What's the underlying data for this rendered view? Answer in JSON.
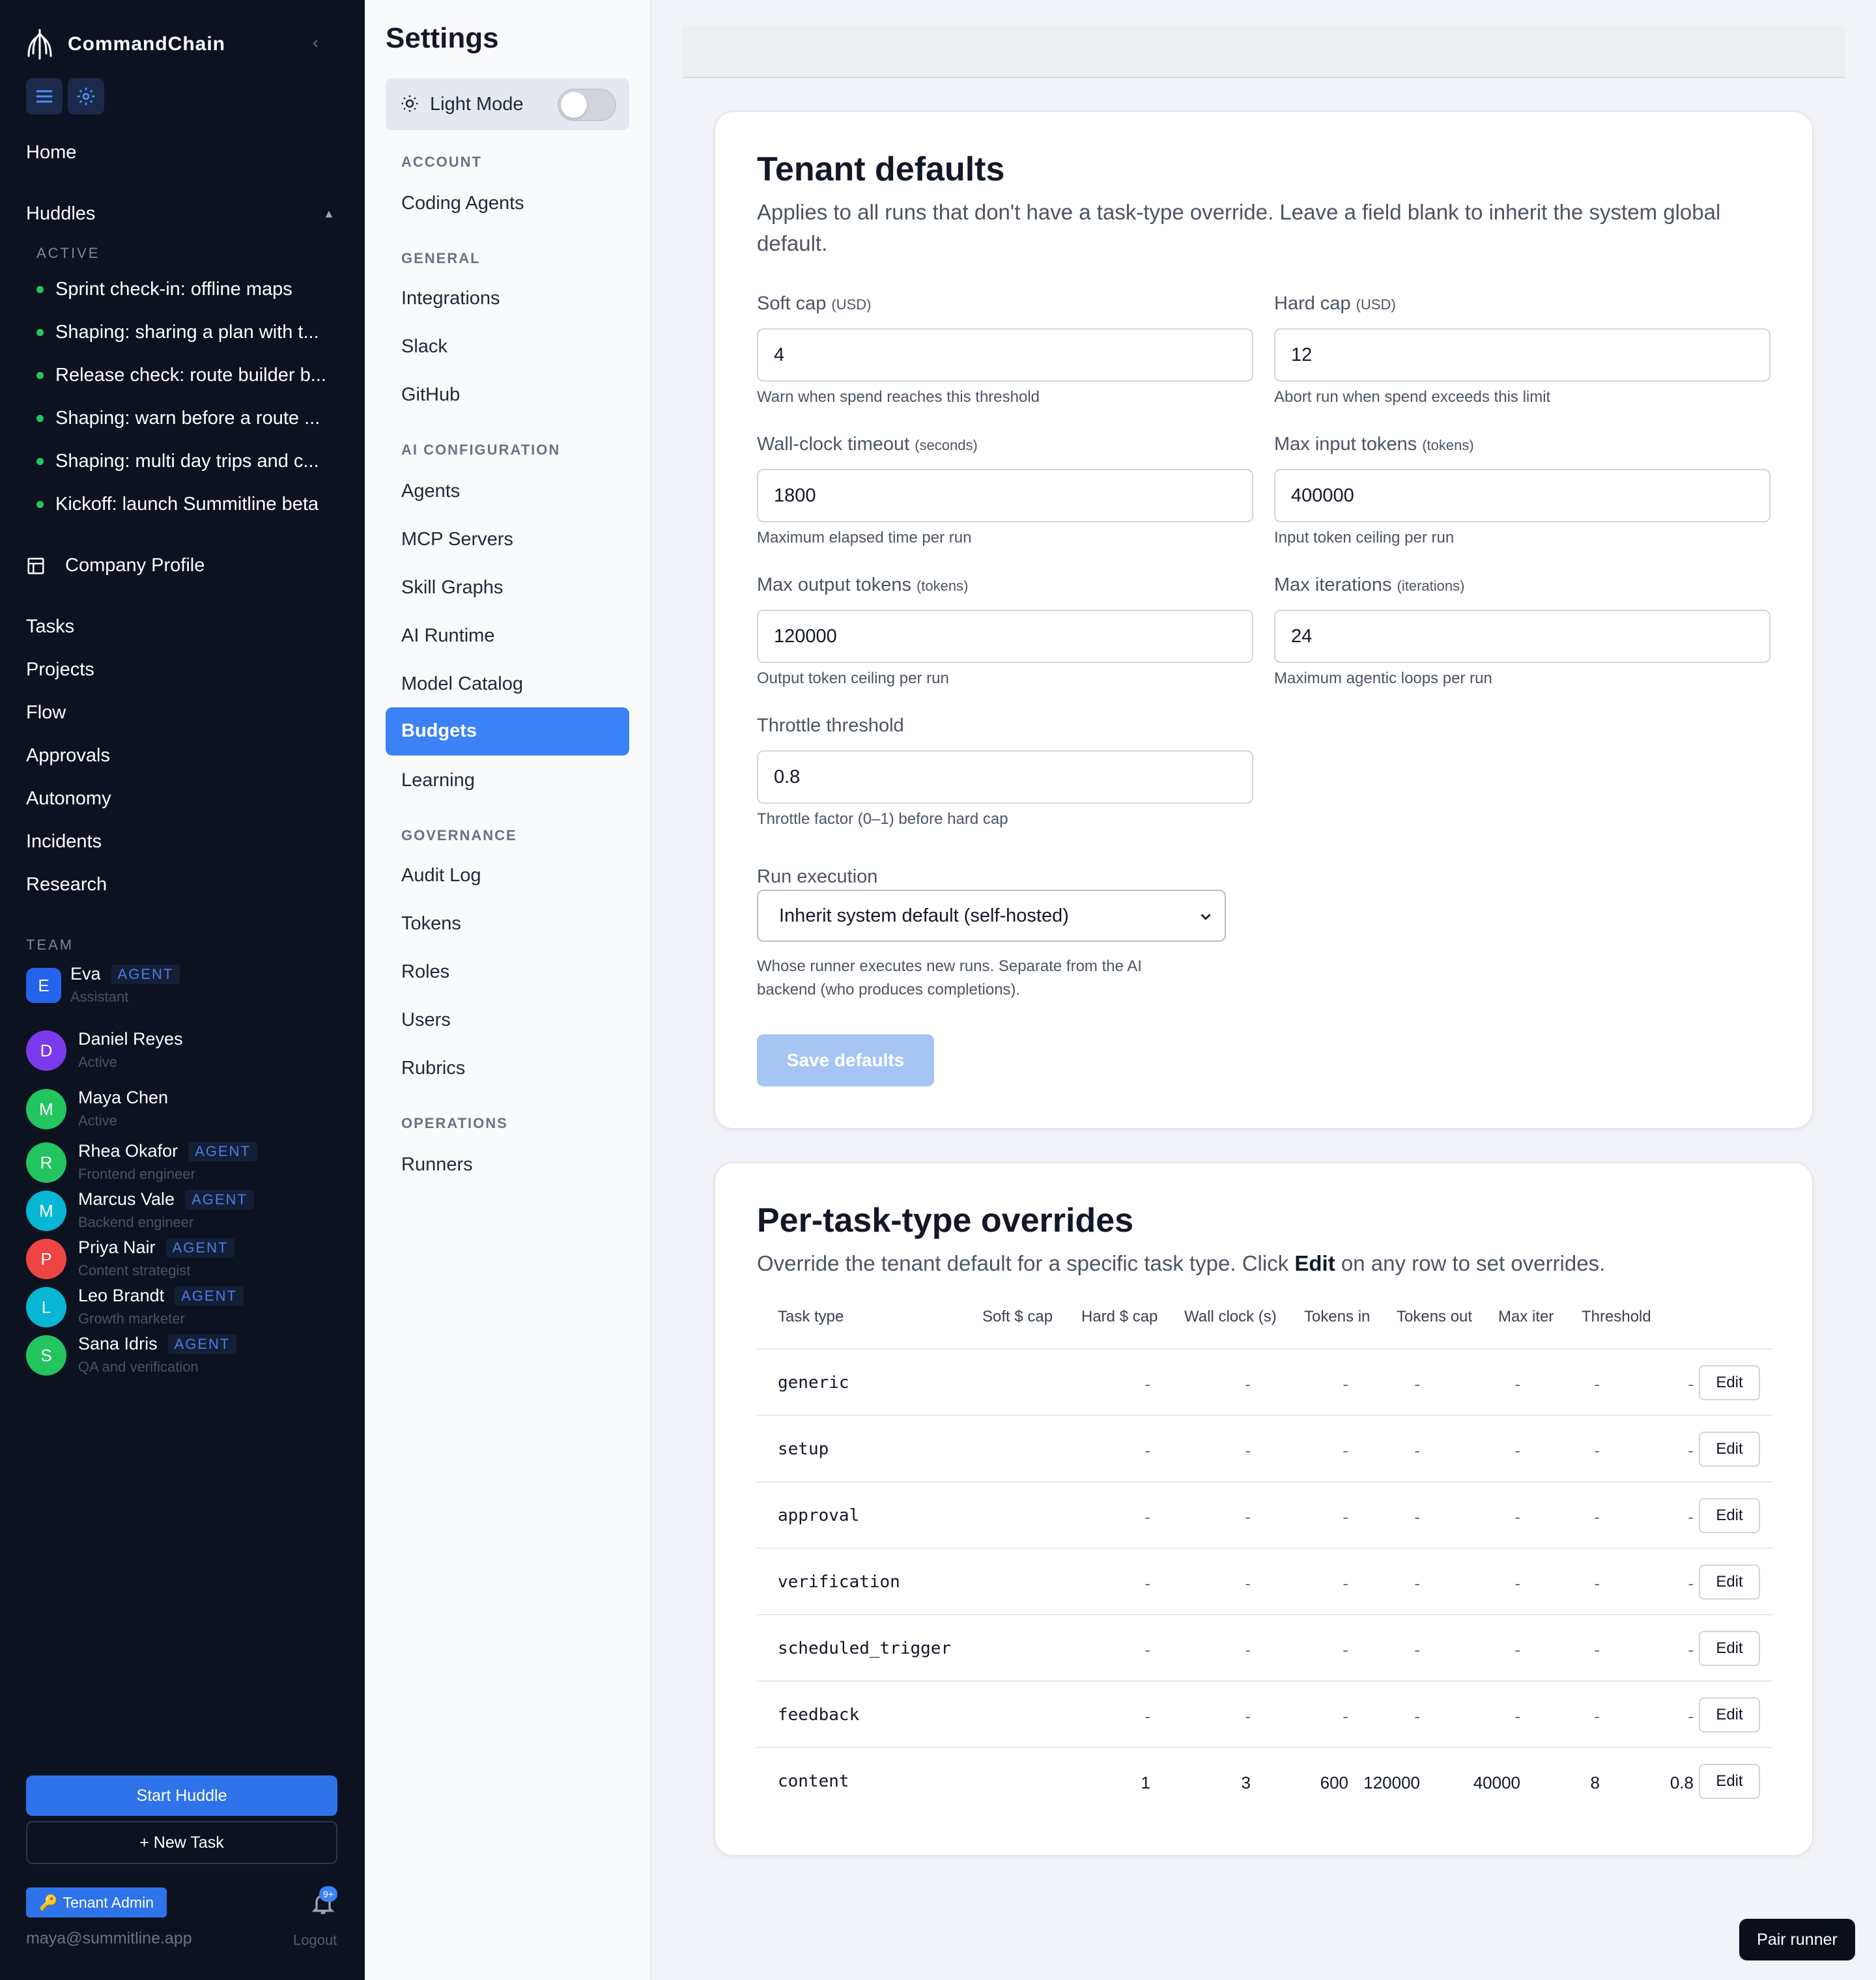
{
  "app": {
    "brand": "CommandChain",
    "collapse": "‹",
    "nav_top": [
      "Home"
    ],
    "huddles_label": "Huddles",
    "active_label": "ACTIVE",
    "huddles": [
      "Sprint check-in: offline maps",
      "Shaping: sharing a plan with t...",
      "Release check: route builder b...",
      "Shaping: warn before a route ...",
      "Shaping: multi day trips and c...",
      "Kickoff: launch Summitline beta"
    ],
    "company_profile": "Company Profile",
    "nav_main": [
      "Tasks",
      "Projects",
      "Flow",
      "Approvals",
      "Autonomy",
      "Incidents",
      "Research"
    ],
    "team_label": "TEAM",
    "agent_tag": "AGENT",
    "team": [
      {
        "initial": "E",
        "name": "Eva",
        "sub": "Assistant",
        "agent": true,
        "color": "#2563eb"
      },
      {
        "initial": "D",
        "name": "Daniel Reyes",
        "sub": "Active",
        "agent": false,
        "color": "#7c3aed"
      },
      {
        "initial": "M",
        "name": "Maya Chen",
        "sub": "Active",
        "agent": false,
        "color": "#22c55e"
      },
      {
        "initial": "R",
        "name": "Rhea Okafor",
        "sub": "Frontend engineer",
        "agent": true,
        "color": "#22c55e"
      },
      {
        "initial": "M",
        "name": "Marcus Vale",
        "sub": "Backend engineer",
        "agent": true,
        "color": "#06b6d4"
      },
      {
        "initial": "P",
        "name": "Priya Nair",
        "sub": "Content strategist",
        "agent": true,
        "color": "#ef4444"
      },
      {
        "initial": "L",
        "name": "Leo Brandt",
        "sub": "Growth marketer",
        "agent": true,
        "color": "#06b6d4"
      },
      {
        "initial": "S",
        "name": "Sana Idris",
        "sub": "QA and verification",
        "agent": true,
        "color": "#22c55e"
      }
    ],
    "start_huddle": "Start Huddle",
    "new_task": "+ New Task",
    "tenant_admin": "Tenant Admin",
    "notif_count": "9+",
    "email": "maya@summitline.app",
    "logout": "Logout"
  },
  "settings": {
    "title": "Settings",
    "light_mode": "Light Mode",
    "sections": [
      {
        "label": "ACCOUNT",
        "items": [
          "Coding Agents"
        ]
      },
      {
        "label": "GENERAL",
        "items": [
          "Integrations",
          "Slack",
          "GitHub"
        ]
      },
      {
        "label": "AI CONFIGURATION",
        "items": [
          "Agents",
          "MCP Servers",
          "Skill Graphs",
          "AI Runtime",
          "Model Catalog",
          "Budgets",
          "Learning"
        ]
      },
      {
        "label": "GOVERNANCE",
        "items": [
          "Audit Log",
          "Tokens",
          "Roles",
          "Users",
          "Rubrics"
        ]
      },
      {
        "label": "OPERATIONS",
        "items": [
          "Runners"
        ]
      }
    ],
    "active_item": "Budgets"
  },
  "defaults": {
    "title": "Tenant defaults",
    "description": "Applies to all runs that don't have a task-type override. Leave a field blank to inherit the system global default.",
    "fields": [
      {
        "label": "Soft cap",
        "unit": "(USD)",
        "value": "4",
        "help": "Warn when spend reaches this threshold"
      },
      {
        "label": "Hard cap",
        "unit": "(USD)",
        "value": "12",
        "help": "Abort run when spend exceeds this limit"
      },
      {
        "label": "Wall-clock timeout",
        "unit": "(seconds)",
        "value": "1800",
        "help": "Maximum elapsed time per run"
      },
      {
        "label": "Max input tokens",
        "unit": "(tokens)",
        "value": "400000",
        "help": "Input token ceiling per run"
      },
      {
        "label": "Max output tokens",
        "unit": "(tokens)",
        "value": "120000",
        "help": "Output token ceiling per run"
      },
      {
        "label": "Max iterations",
        "unit": "(iterations)",
        "value": "24",
        "help": "Maximum agentic loops per run"
      },
      {
        "label": "Throttle threshold",
        "unit": "",
        "value": "0.8",
        "help": "Throttle factor (0–1) before hard cap"
      }
    ],
    "run_execution": {
      "label": "Run execution",
      "selected": "Inherit system default (self-hosted)",
      "help_line1": "Whose runner executes new runs. Separate from the AI",
      "help_line2": "backend (who produces completions)."
    },
    "save_button": "Save defaults"
  },
  "overrides": {
    "title": "Per-task-type overrides",
    "desc_before": "Override the tenant default for a specific task type. Click ",
    "desc_bold": "Edit",
    "desc_after": " on any row to set overrides.",
    "columns": [
      "Task type",
      "Soft $ cap",
      "Hard $ cap",
      "Wall clock (s)",
      "Tokens in",
      "Tokens out",
      "Max iter",
      "Threshold"
    ],
    "edit_label": "Edit",
    "rows": [
      {
        "type": "generic",
        "values": [
          "-",
          "-",
          "-",
          "-",
          "-",
          "-",
          "-"
        ]
      },
      {
        "type": "setup",
        "values": [
          "-",
          "-",
          "-",
          "-",
          "-",
          "-",
          "-"
        ]
      },
      {
        "type": "approval",
        "values": [
          "-",
          "-",
          "-",
          "-",
          "-",
          "-",
          "-"
        ]
      },
      {
        "type": "verification",
        "values": [
          "-",
          "-",
          "-",
          "-",
          "-",
          "-",
          "-"
        ]
      },
      {
        "type": "scheduled_trigger",
        "values": [
          "-",
          "-",
          "-",
          "-",
          "-",
          "-",
          "-"
        ]
      },
      {
        "type": "feedback",
        "values": [
          "-",
          "-",
          "-",
          "-",
          "-",
          "-",
          "-"
        ]
      },
      {
        "type": "content",
        "values": [
          "1",
          "3",
          "600",
          "120000",
          "40000",
          "8",
          "0.8"
        ]
      }
    ]
  },
  "pair_runner": "Pair runner"
}
